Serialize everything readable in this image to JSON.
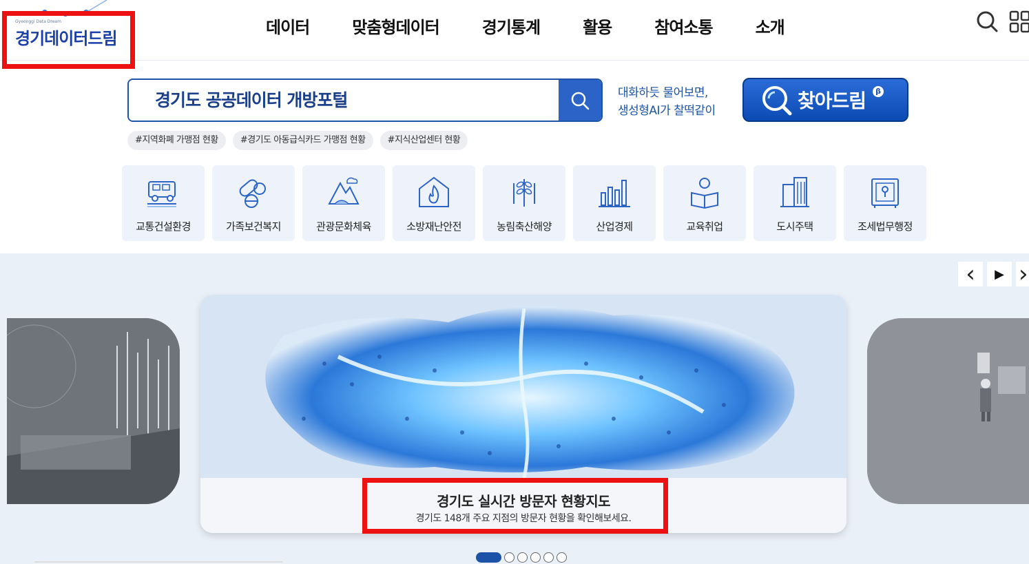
{
  "logo": {
    "small_text": "Gyeonggi Data Dream",
    "text": "경기데이터드림"
  },
  "nav": [
    "데이터",
    "맞춤형데이터",
    "경기통계",
    "활용",
    "참여소통",
    "소개"
  ],
  "search": {
    "placeholder": "경기도 공공데이터 개방포털"
  },
  "ai": {
    "line1": "대화하듯 물어보면,",
    "line2": "생성형AI가 찰떡같이",
    "button_label": "찾아드림",
    "badge": "β"
  },
  "tags": [
    "#지역화폐 가맹점 현황",
    "#경기도 아동급식카드 가맹점 현황",
    "#지식산업센터 현황"
  ],
  "categories": [
    {
      "label": "교통건설환경",
      "icon": "car-icon"
    },
    {
      "label": "가족보건복지",
      "icon": "pill-icon"
    },
    {
      "label": "관광문화체육",
      "icon": "mountain-icon"
    },
    {
      "label": "소방재난안전",
      "icon": "fire-house-icon"
    },
    {
      "label": "농림축산해양",
      "icon": "wheat-icon"
    },
    {
      "label": "산업경제",
      "icon": "bar-chart-icon"
    },
    {
      "label": "교육취업",
      "icon": "reader-icon"
    },
    {
      "label": "도시주택",
      "icon": "building-icon"
    },
    {
      "label": "조세법무행정",
      "icon": "safe-icon"
    }
  ],
  "banner": {
    "title": "경기도 실시간 방문자 현황지도",
    "subtitle": "경기도 148개 주요 지점의 방문자 현황을 확인해보세요.",
    "prev": "‹",
    "play": "▶",
    "next": "›",
    "slides_total": 6,
    "active_slide": 1
  },
  "colors": {
    "brand": "#1c53a8",
    "highlight": "#ee1111",
    "banner_bg": "#eaf0f8"
  }
}
